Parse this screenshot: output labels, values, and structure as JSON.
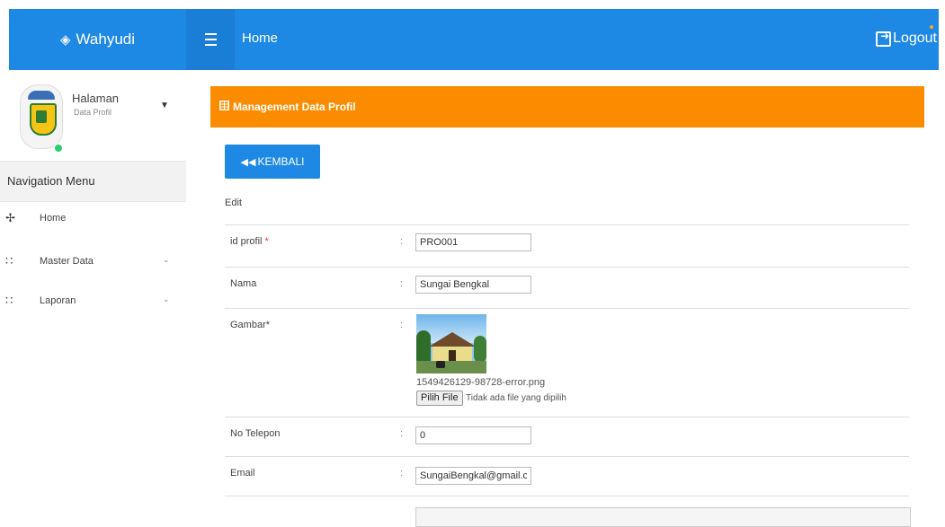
{
  "brand": {
    "icon": "cube-icon",
    "name": "Wahyudi"
  },
  "topbar": {
    "title": "Home",
    "logout_label": "Logout",
    "accent_color": "#1e88e5"
  },
  "sidebar": {
    "profile": {
      "name": "Halaman",
      "subtitle": "Data Profil",
      "status_color": "#2ecc71"
    },
    "nav_header": "Navigation Menu",
    "items": [
      {
        "icon": "move-arrows-icon",
        "label": "Home",
        "has_submenu": false
      },
      {
        "icon": "grid-dots-icon",
        "label": "Master Data",
        "has_submenu": true
      },
      {
        "icon": "grid-dots-icon",
        "label": "Laporan",
        "has_submenu": true
      }
    ]
  },
  "main": {
    "panel_title": "Management Data Profil",
    "panel_color": "#fb8c00",
    "back_button": "KEMBALI",
    "section_label": "Edit",
    "fields": {
      "id_profil": {
        "label": "id profil",
        "required_mark": "*",
        "value": "PRO001"
      },
      "nama": {
        "label": "Nama",
        "value": "Sungai Bengkal"
      },
      "gambar": {
        "label": "Gambar*",
        "file_name": "1549426129-98728-error.png",
        "choose_button": "Pilih File",
        "choose_status": "Tidak ada file yang dipilih"
      },
      "no_telepon": {
        "label": "No Telepon",
        "value": "0"
      },
      "email": {
        "label": "Email",
        "value": "SungaiBengkal@gmail.com"
      }
    },
    "separator": ":"
  }
}
